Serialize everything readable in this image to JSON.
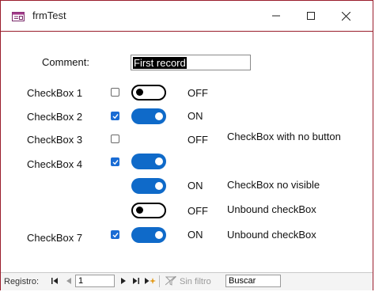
{
  "window": {
    "title": "frmTest"
  },
  "form": {
    "comment_label": "Comment:",
    "comment_value": "First record",
    "rows": [
      {
        "label": "CheckBox 1",
        "checkbox_checked": false,
        "toggle_on": false,
        "state": "OFF",
        "note": ""
      },
      {
        "label": "CheckBox 2",
        "checkbox_checked": true,
        "toggle_on": true,
        "state": "ON",
        "note": ""
      },
      {
        "label": "CheckBox 3",
        "checkbox_checked": false,
        "toggle": null,
        "state": "OFF",
        "note": "CheckBox with no button"
      },
      {
        "label": "CheckBox 4",
        "checkbox_checked": true,
        "toggle_on": true,
        "state": "",
        "note": ""
      },
      {
        "label": "",
        "checkbox": null,
        "toggle_on": true,
        "state": "ON",
        "note": "CheckBox no visible"
      },
      {
        "label": "",
        "checkbox": null,
        "toggle_on": false,
        "state": "OFF",
        "note": "Unbound checkBox"
      },
      {
        "label": "CheckBox 7",
        "checkbox_checked": true,
        "toggle_on": true,
        "state": "ON",
        "note": "Unbound checkBox"
      }
    ]
  },
  "navigation": {
    "record_label": "Registro:",
    "current_record": "1",
    "filter_label": "Sin filtro",
    "search_placeholder": "Buscar"
  },
  "colors": {
    "accent": "#0f6ac9",
    "border": "#9a1d2c"
  }
}
